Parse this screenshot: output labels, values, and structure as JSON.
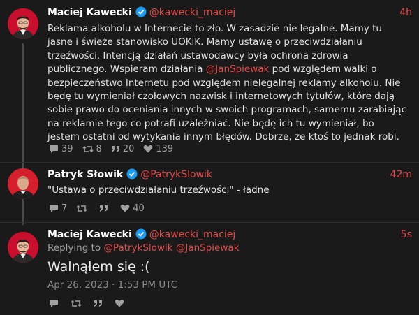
{
  "tweets": [
    {
      "author": "Maciej Kawecki",
      "handle": "@kawecki_maciej",
      "time": "4h",
      "text_parts": [
        "Reklama alkoholu w Internecie to zło. W zasadzie nie legalne. Mamy tu jasne i świeże stanowisko UOKiK. Mamy ustawę o przeciwdziałaniu trzeźwości. Intencją działań ustawodawcy była ochrona zdrowia publicznego. Wspieram działania ",
        "@JanSpiewak",
        " pod względem walki o bezpieczeństwo Internetu pod względem nielegalnej reklamy alkoholu. Nie będę tu wymieniał czołowych nazwisk i internetowych tytułów, które dają sobie prawo do oceniania innych w swoich programach, samemu zarabiając na reklamie tego co potrafi uzależniać. Nie będę ich tu wymieniał, bo jestem ostatni od wytykania innym błędów. Dobrze, że ktoś to jednak robi."
      ],
      "stats": {
        "replies": "39",
        "retweets": "8",
        "quotes": "20",
        "likes": "139"
      }
    },
    {
      "author": "Patryk Słowik",
      "handle": "@PatrykSlowik",
      "time": "42m",
      "text": "\"Ustawa o przeciwdziałaniu trzeźwości\" - ładne",
      "stats": {
        "replies": "7",
        "retweets": "",
        "quotes": "",
        "likes": "40"
      }
    },
    {
      "author": "Maciej Kawecki",
      "handle": "@kawecki_maciej",
      "time": "5s",
      "replying_label": "Replying to",
      "replying_to": [
        "@PatrykSlowik",
        "@JanSpiewak"
      ],
      "text": "Walnąłem się :(",
      "timestamp": "Apr 26, 2023 · 1:53 PM UTC"
    }
  ],
  "colors": {
    "accent": "#e04b4b",
    "verified": "#1d9bf0",
    "background": "#1a1a1a"
  },
  "icons": [
    "reply-icon",
    "retweet-icon",
    "quote-icon",
    "like-icon",
    "verified-badge-icon"
  ]
}
